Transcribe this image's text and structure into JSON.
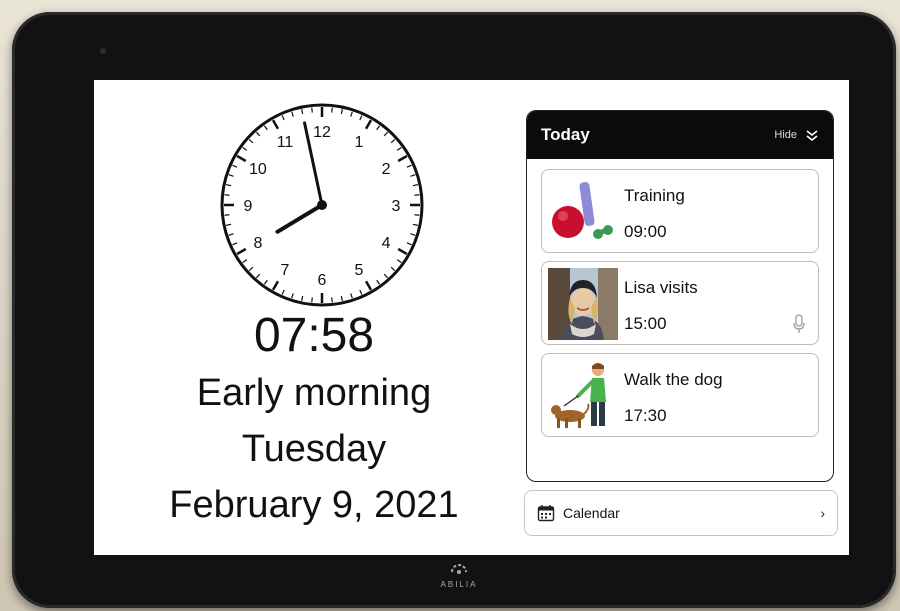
{
  "clock": {
    "hour": 7,
    "minute": 58,
    "numbers": [
      "12",
      "1",
      "2",
      "3",
      "4",
      "5",
      "6",
      "7",
      "8",
      "9",
      "10",
      "11"
    ]
  },
  "digital_time": "07:58",
  "day_period": "Early morning",
  "weekday": "Tuesday",
  "date": "February 9, 2021",
  "agenda": {
    "title": "Today",
    "hide_label": "Hide",
    "activities": [
      {
        "name": "Training",
        "time": "09:00",
        "icon": "training-equipment-icon"
      },
      {
        "name": "Lisa visits",
        "time": "15:00",
        "icon": "lisa-photo",
        "has_audio": true
      },
      {
        "name": "Walk the dog",
        "time": "17:30",
        "icon": "walk-dog-icon"
      }
    ]
  },
  "calendar_label": "Calendar",
  "brand": "ABILIA",
  "colors": {
    "header_bg": "#0b0b0b",
    "accent_ball": "#c8102e"
  }
}
